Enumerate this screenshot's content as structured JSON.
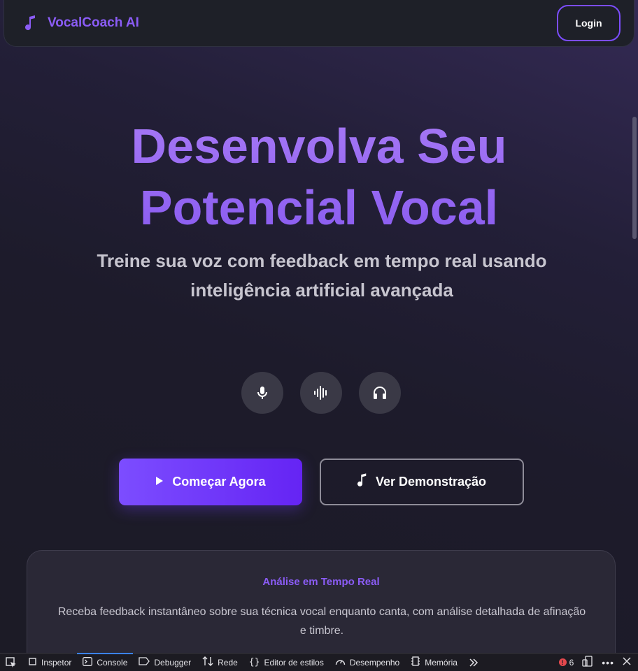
{
  "navbar": {
    "brand": "VocalCoach AI",
    "brand_icon": "music-note-icon",
    "login_label": "Login"
  },
  "hero": {
    "title_line1": "Desenvolva Seu",
    "title_line2": "Potencial Vocal",
    "subtitle_line1": "Treine sua voz com feedback em tempo real usando",
    "subtitle_line2": "inteligência artificial avançada"
  },
  "feature_icons": [
    "microphone-icon",
    "waveform-icon",
    "headphones-icon"
  ],
  "cta": {
    "primary_label": "Começar Agora",
    "secondary_label": "Ver Demonstração"
  },
  "feature_card": {
    "title": "Análise em Tempo Real",
    "description": "Receba feedback instantâneo sobre sua técnica vocal enquanto canta, com análise detalhada de afinação e timbre."
  },
  "devtools": {
    "tabs": [
      "Inspetor",
      "Console",
      "Debugger",
      "Rede",
      "Editor de estilos",
      "Desempenho",
      "Memória"
    ],
    "active_tab": "Console",
    "error_count": "6"
  },
  "colors": {
    "accent": "#8b5cf6",
    "primary_button": "#7c4dff",
    "background": "#1e1c2c"
  }
}
